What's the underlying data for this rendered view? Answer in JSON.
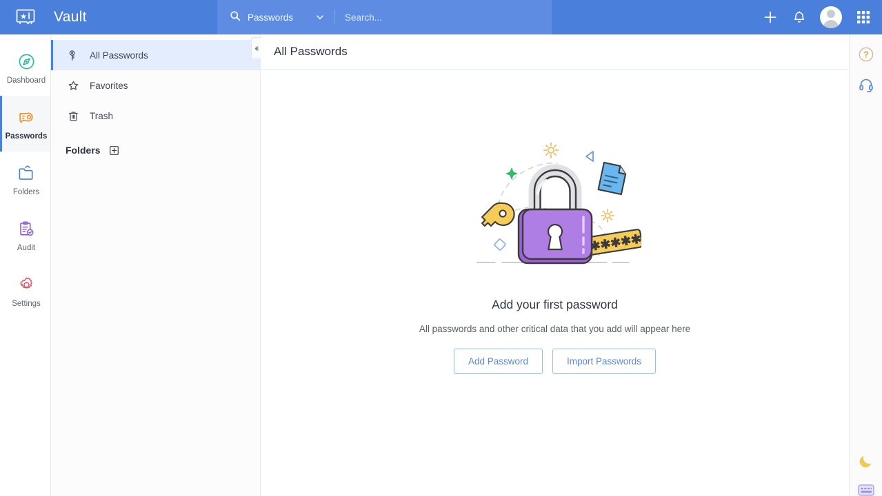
{
  "app": {
    "brand_title": "Vault",
    "logo_icon": "vault-safe-icon"
  },
  "search": {
    "scope_label": "Passwords",
    "scope_icon": "search-icon",
    "caret_icon": "chevron-down-icon",
    "placeholder": "Search...",
    "value": ""
  },
  "topbar_actions": [
    {
      "name": "add-button",
      "icon": "plus-icon"
    },
    {
      "name": "notifications-button",
      "icon": "bell-icon"
    },
    {
      "name": "user-avatar",
      "icon": "avatar-icon"
    },
    {
      "name": "apps-grid-button",
      "icon": "grid-apps-icon"
    }
  ],
  "sidebar": {
    "items": [
      {
        "label": "Dashboard",
        "icon": "compass-icon",
        "color": "#2eb8a0",
        "active": false
      },
      {
        "label": "Passwords",
        "icon": "key-card-icon",
        "color": "#f0942f",
        "active": true
      },
      {
        "label": "Folders",
        "icon": "folder-icon",
        "color": "#4a7fdc",
        "active": false
      },
      {
        "label": "Audit",
        "icon": "clipboard-check-icon",
        "color": "#8e5ed8",
        "active": false
      },
      {
        "label": "Settings",
        "icon": "gear-icon",
        "color": "#e85a6a",
        "active": false
      }
    ]
  },
  "list_panel": {
    "items": [
      {
        "label": "All Passwords",
        "icon": "key-tag-icon",
        "active": true
      },
      {
        "label": "Favorites",
        "icon": "star-icon",
        "active": false
      },
      {
        "label": "Trash",
        "icon": "trash-icon",
        "active": false
      }
    ],
    "folders_section": {
      "title": "Folders",
      "add_icon": "add-folder-icon"
    },
    "collapse_icon": "collapse-left-icon"
  },
  "main": {
    "title": "All Passwords",
    "empty_state": {
      "illustration": "padlock-illustration",
      "title": "Add your first password",
      "subtitle": "All passwords and other critical data that you add will appear here",
      "primary_button": "Add Password",
      "secondary_button": "Import Passwords",
      "password_tag_text": "*****"
    }
  },
  "right_rail": {
    "top_items": [
      {
        "name": "help-button",
        "icon": "question-circle-icon",
        "color": "#e8a33d"
      },
      {
        "name": "support-button",
        "icon": "headset-icon",
        "color": "#6d9ae8"
      }
    ],
    "bottom_items": [
      {
        "name": "dark-mode-toggle",
        "icon": "moon-icon",
        "color": "#f2c94c"
      },
      {
        "name": "keyboard-shortcuts-button",
        "icon": "keyboard-icon",
        "color": "#b3a8e0"
      }
    ]
  },
  "colors": {
    "brand_blue": "#4a7fdc",
    "search_blue": "#5d8ce2",
    "active_row": "#e3edfd",
    "panel_bg": "#fcfcfc",
    "lock_purple": "#a972de",
    "key_yellow": "#f2c94c"
  }
}
